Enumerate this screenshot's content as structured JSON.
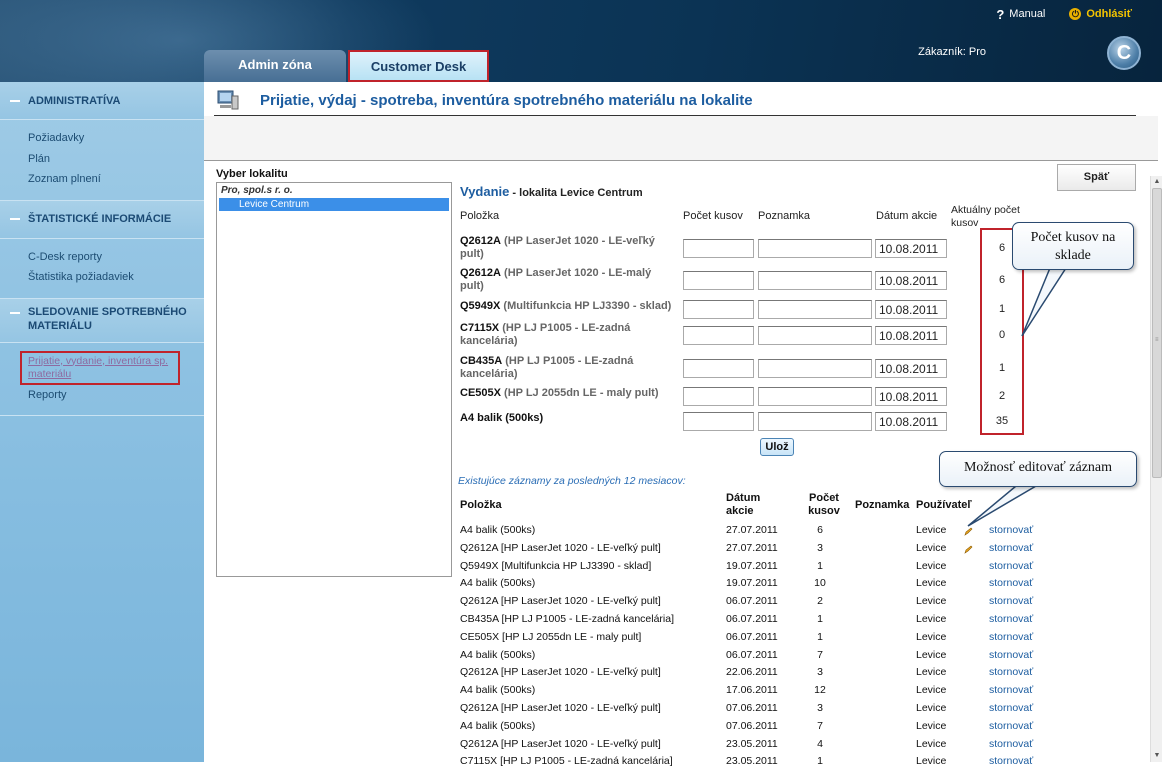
{
  "header": {
    "manual_label": "Manual",
    "logout_label": "Odhlásiť",
    "tabs": [
      {
        "label": "Admin zóna"
      },
      {
        "label": "Customer Desk"
      }
    ],
    "customer_prefix": "Zákazník:",
    "customer_name": "Pro",
    "logo_letter": "C"
  },
  "sidebar": {
    "sections": [
      {
        "title": "ADMINISTRATÍVA",
        "items": [
          "Požiadavky",
          "Plán",
          "Zoznam plnení"
        ]
      },
      {
        "title": "ŠTATISTICKÉ INFORMÁCIE",
        "items": [
          "C-Desk reporty",
          "Štatistika požiadaviek"
        ]
      },
      {
        "title_line1": "SLEDOVANIE SPOTREBNÉHO",
        "title_line2": "MATERIÁLU",
        "items": [
          "Prijatie, vydanie, inventúra sp.",
          "materiálu",
          "Reporty"
        ]
      }
    ]
  },
  "main": {
    "page_title": "Prijatie, výdaj - spotreba, inventúra spotrebného materiálu na lokalite",
    "back_label": "Späť",
    "vyber_label": "Vyber lokalitu",
    "locations": {
      "parent": "Pro, spol.s r. o.",
      "child": "Levice Centrum"
    },
    "vydanie_title": "Vydanie",
    "vydanie_sub": " - lokalita Levice Centrum",
    "columns": {
      "polozka": "Položka",
      "pocet": "Počet kusov",
      "poznamka": "Poznamka",
      "datum": "Dátum akcie",
      "aktualny_1": "Aktuálny počet",
      "aktualny_2": "kusov"
    },
    "items": [
      {
        "code": "Q2612A",
        "desc1": " (HP LaserJet 1020 - LE-veľký",
        "desc2": "pult)",
        "date": "10.08.2011",
        "qty": "6"
      },
      {
        "code": "Q2612A",
        "desc1": " (HP LaserJet 1020 - LE-malý",
        "desc2": "pult)",
        "date": "10.08.2011",
        "qty": "6"
      },
      {
        "code": "Q5949X",
        "desc1": " (Multifunkcia HP LJ3390 - sklad)",
        "desc2": "",
        "date": "10.08.2011",
        "qty": "1"
      },
      {
        "code": "C7115X",
        "desc1": " (HP LJ P1005 - LE-zadná",
        "desc2": "kancelária)",
        "date": "10.08.2011",
        "qty": "0"
      },
      {
        "code": "CB435A",
        "desc1": " (HP LJ P1005 - LE-zadná",
        "desc2": "kancelária)",
        "date": "10.08.2011",
        "qty": "1"
      },
      {
        "code": "CE505X",
        "desc1": " (HP LJ 2055dn LE - maly pult)",
        "desc2": "",
        "date": "10.08.2011",
        "qty": "2"
      },
      {
        "code": "A4 balik (500ks)",
        "desc1": "",
        "desc2": "",
        "date": "10.08.2011",
        "qty": "35"
      }
    ],
    "save_label": "Ulož",
    "existing_title": "Existujúce záznamy za posledných 12 mesiacov:",
    "rec_headers": {
      "polozka": "Položka",
      "datum_1": "Dátum",
      "datum_2": "akcie",
      "pocet_1": "Počet",
      "pocet_2": "kusov",
      "poznamka": "Poznamka",
      "pouzivatel": "Používateľ"
    },
    "records": [
      {
        "item": "A4 balik (500ks)",
        "date": "27.07.2011",
        "qty": "6",
        "user": "Levice",
        "edit": true,
        "action": "stornovať"
      },
      {
        "item": "Q2612A [HP LaserJet 1020 - LE-veľký pult]",
        "date": "27.07.2011",
        "qty": "3",
        "user": "Levice",
        "edit": true,
        "action": "stornovať"
      },
      {
        "item": "Q5949X [Multifunkcia HP LJ3390 - sklad]",
        "date": "19.07.2011",
        "qty": "1",
        "user": "Levice",
        "edit": false,
        "action": "stornovať"
      },
      {
        "item": "A4 balik (500ks)",
        "date": "19.07.2011",
        "qty": "10",
        "user": "Levice",
        "edit": false,
        "action": "stornovať"
      },
      {
        "item": "Q2612A [HP LaserJet 1020 - LE-veľký pult]",
        "date": "06.07.2011",
        "qty": "2",
        "user": "Levice",
        "edit": false,
        "action": "stornovať"
      },
      {
        "item": "CB435A [HP LJ P1005 - LE-zadná kancelária]",
        "date": "06.07.2011",
        "qty": "1",
        "user": "Levice",
        "edit": false,
        "action": "stornovať"
      },
      {
        "item": "CE505X [HP LJ 2055dn LE - maly pult]",
        "date": "06.07.2011",
        "qty": "1",
        "user": "Levice",
        "edit": false,
        "action": "stornovať"
      },
      {
        "item": "A4 balik (500ks)",
        "date": "06.07.2011",
        "qty": "7",
        "user": "Levice",
        "edit": false,
        "action": "stornovať"
      },
      {
        "item": "Q2612A [HP LaserJet 1020 - LE-veľký pult]",
        "date": "22.06.2011",
        "qty": "3",
        "user": "Levice",
        "edit": false,
        "action": "stornovať"
      },
      {
        "item": "A4 balik (500ks)",
        "date": "17.06.2011",
        "qty": "12",
        "user": "Levice",
        "edit": false,
        "action": "stornovať"
      },
      {
        "item": "Q2612A [HP LaserJet 1020 - LE-veľký pult]",
        "date": "07.06.2011",
        "qty": "3",
        "user": "Levice",
        "edit": false,
        "action": "stornovať"
      },
      {
        "item": "A4 balik (500ks)",
        "date": "07.06.2011",
        "qty": "7",
        "user": "Levice",
        "edit": false,
        "action": "stornovať"
      },
      {
        "item": "Q2612A [HP LaserJet 1020 - LE-veľký pult]",
        "date": "23.05.2011",
        "qty": "4",
        "user": "Levice",
        "edit": false,
        "action": "stornovať"
      },
      {
        "item": "C7115X [HP LJ P1005 - LE-zadná kancelária]",
        "date": "23.05.2011",
        "qty": "1",
        "user": "Levice",
        "edit": false,
        "action": "stornovať"
      }
    ]
  },
  "callouts": {
    "stock_line1": "Počet kusov na",
    "stock_line2": "sklade",
    "edit": "Možnosť editovať záznam"
  },
  "colors": {
    "highlight": "#c0232b",
    "title_blue": "#1d5da0"
  }
}
